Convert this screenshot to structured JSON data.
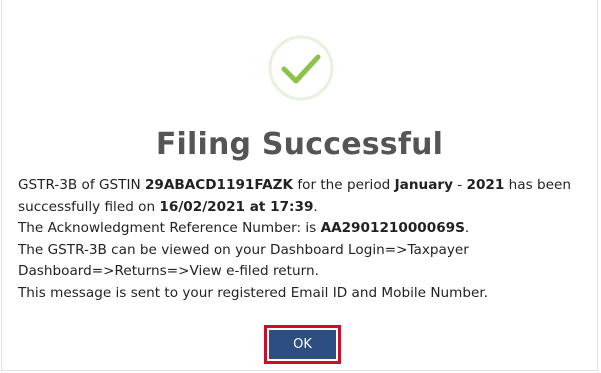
{
  "dialog": {
    "title": "Filing Successful",
    "icon": "check-circle-icon",
    "accent_color": "#2d4e80",
    "check_color": "#8bc34a",
    "message": {
      "line1_prefix": "GSTR-3B of GSTIN ",
      "gstin": "29ABACD1191FAZK",
      "line1_mid": " for the period ",
      "period_month": "January",
      "period_sep": " - ",
      "period_year": "2021",
      "line1_suffix": " has been successfully filed on ",
      "filed_on": "16/02/2021 at 17:39",
      "line1_end": ".",
      "ack_prefix": "The Acknowledgment Reference Number: is ",
      "ack_number": "AA290121000069S",
      "ack_end": ".",
      "view_text": "The GSTR-3B can be viewed on your Dashboard Login=>Taxpayer Dashboard=>Returns=>View e-filed return.",
      "notify_text": "This message is sent to your registered Email ID and Mobile Number."
    },
    "ok_label": "OK"
  }
}
